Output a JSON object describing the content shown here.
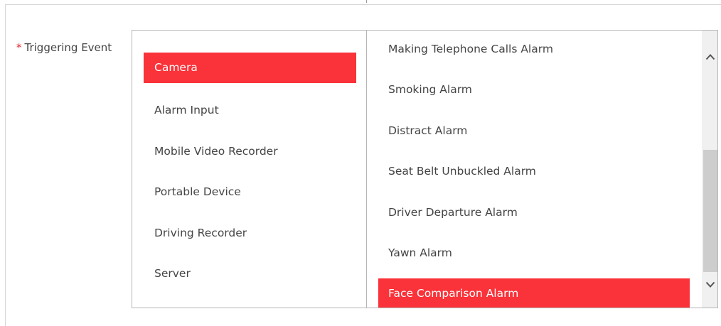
{
  "form": {
    "required_marker": "*",
    "triggering_event_label": "Triggering Event"
  },
  "categories": [
    {
      "label": "Camera",
      "selected": true
    },
    {
      "label": "Alarm Input",
      "selected": false
    },
    {
      "label": "Mobile Video Recorder",
      "selected": false
    },
    {
      "label": "Portable Device",
      "selected": false
    },
    {
      "label": "Driving Recorder",
      "selected": false
    },
    {
      "label": "Server",
      "selected": false
    }
  ],
  "events": [
    {
      "label": "Making Telephone Calls Alarm",
      "selected": false
    },
    {
      "label": "Smoking Alarm",
      "selected": false
    },
    {
      "label": "Distract Alarm",
      "selected": false
    },
    {
      "label": "Seat Belt Unbuckled Alarm",
      "selected": false
    },
    {
      "label": "Driver Departure Alarm",
      "selected": false
    },
    {
      "label": "Yawn Alarm",
      "selected": false
    },
    {
      "label": "Face Comparison Alarm",
      "selected": true
    }
  ],
  "icons": {
    "scroll_up": "chevron-up-icon",
    "scroll_down": "chevron-down-icon"
  },
  "colors": {
    "selection": "#fa3239",
    "required": "#e0282e"
  }
}
